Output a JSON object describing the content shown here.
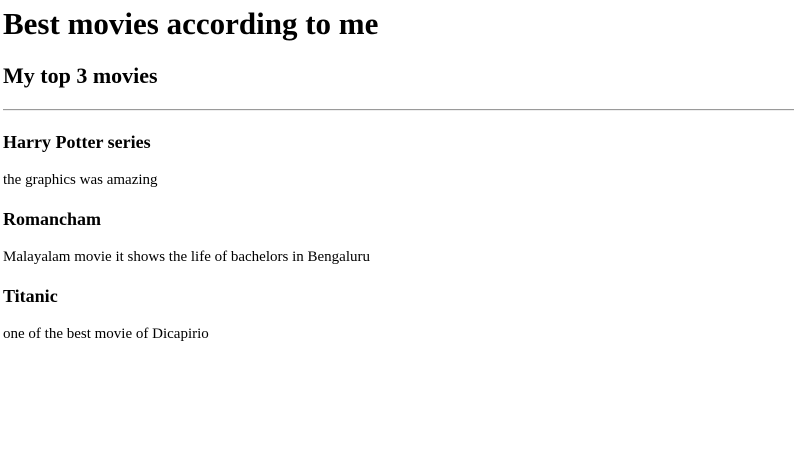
{
  "page": {
    "title": "Best movies according to me",
    "subtitle": "My top 3 movies"
  },
  "movies": [
    {
      "title": "Harry Potter series",
      "description": "the graphics was amazing"
    },
    {
      "title": "Romancham",
      "description": "Malayalam movie it shows the life of bachelors in Bengaluru"
    },
    {
      "title": "Titanic",
      "description": "one of the best movie of Dicapirio"
    }
  ]
}
